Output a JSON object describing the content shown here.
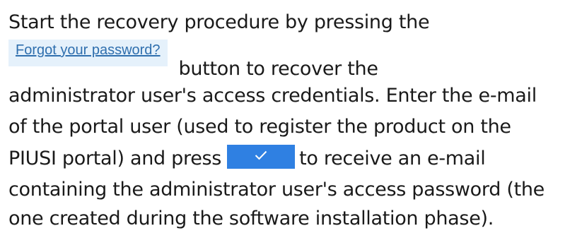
{
  "text": {
    "line1": "Start the recovery procedure by pressing the",
    "forgot_button_label": "Forgot your password?",
    "line2_after": "button to recover the",
    "line3": "administrator user's access credentials. Enter the e-mail",
    "line4": "of the portal user (used to register the product on the",
    "line5_before": "PIUSI portal) and press",
    "line5_after": "to receive an e-mail",
    "line6": "containing the administrator user's access password (the",
    "line7": "one created during the software installation phase)."
  },
  "icons": {
    "confirm": "check-icon"
  },
  "colors": {
    "text": "#1a1a1a",
    "link": "#2f6fae",
    "forgot_button_bg": "#e5f1fb",
    "confirm_button_bg": "#2f80e2"
  }
}
